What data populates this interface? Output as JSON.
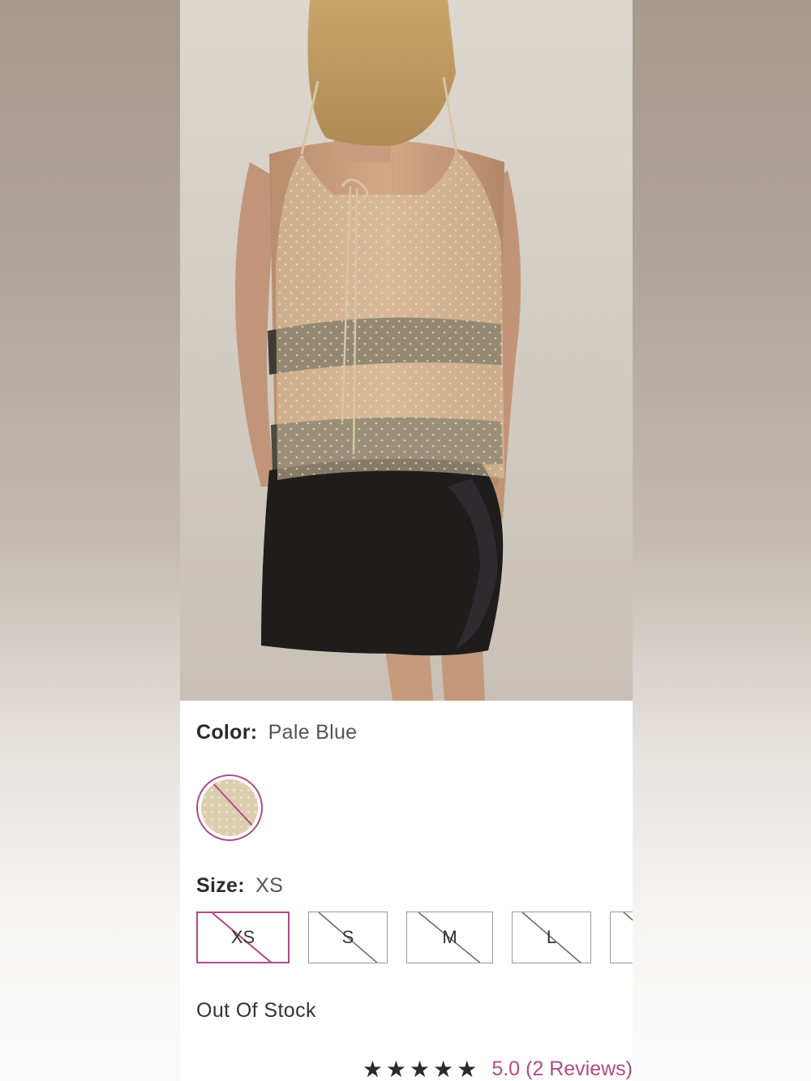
{
  "product": {
    "color_label": "Color:",
    "color_value": "Pale Blue",
    "size_label": "Size:",
    "size_value": "XS",
    "sizes": [
      {
        "label": "XS",
        "selected": true,
        "available": false
      },
      {
        "label": "S",
        "selected": false,
        "available": false
      },
      {
        "label": "M",
        "selected": false,
        "available": false
      },
      {
        "label": "L",
        "selected": false,
        "available": false
      },
      {
        "label": "",
        "selected": false,
        "available": false
      }
    ],
    "stock_status": "Out Of Stock",
    "rating": {
      "stars": "★★★★★",
      "text": "5.0 (2 Reviews)"
    }
  },
  "colors": {
    "accent": "#b04b86",
    "text": "#333333",
    "swatch": "#dccdae"
  },
  "icons": {
    "rating": "star-icon",
    "unavailable": "diagonal-strike-icon"
  }
}
